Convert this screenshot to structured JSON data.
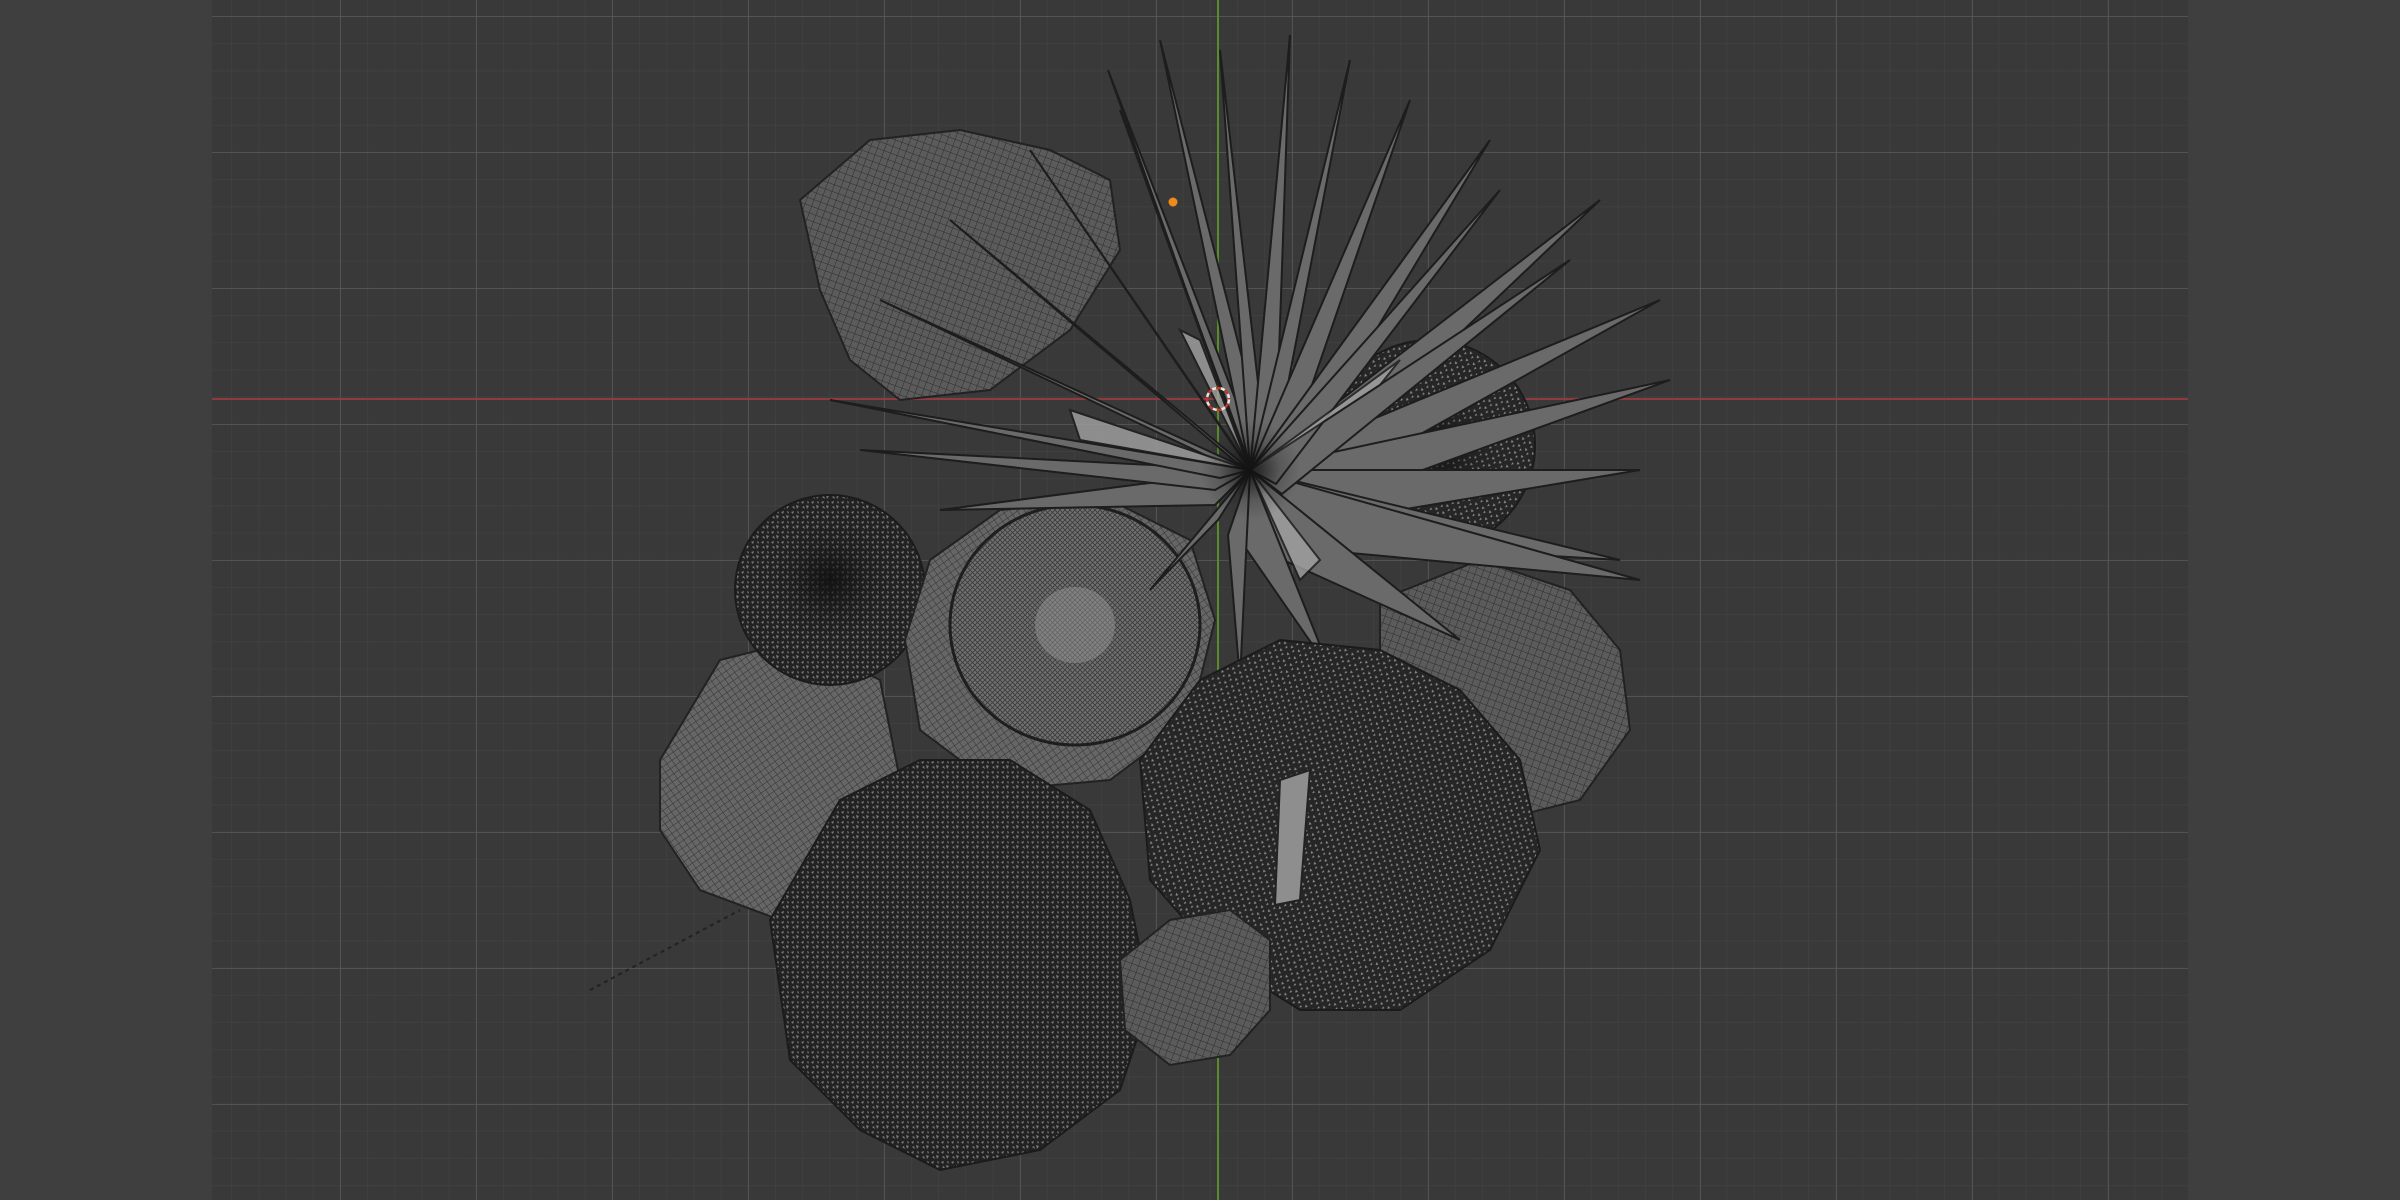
{
  "app": "3D viewport",
  "view": {
    "mode": "wireframe",
    "projection": "top-orthographic",
    "axes": {
      "x_color": "#8e3a40",
      "y_color": "#5a8a2a"
    },
    "background_color": "#3d3d3d"
  },
  "scene": {
    "objects": [
      {
        "name": "rock-top-left"
      },
      {
        "name": "spiky-plant-center"
      },
      {
        "name": "shrub-dense-right"
      },
      {
        "name": "shrub-round-left"
      },
      {
        "name": "cut-stump-center"
      },
      {
        "name": "rock-left"
      },
      {
        "name": "rock-right"
      },
      {
        "name": "shrub-bottom-left"
      },
      {
        "name": "shrub-bottom-center"
      },
      {
        "name": "rock-small-bottom"
      }
    ],
    "cursor_icon": "3d-cursor-icon",
    "origin_icon": "object-origin-icon",
    "light_icon": "light-direction-icon"
  }
}
